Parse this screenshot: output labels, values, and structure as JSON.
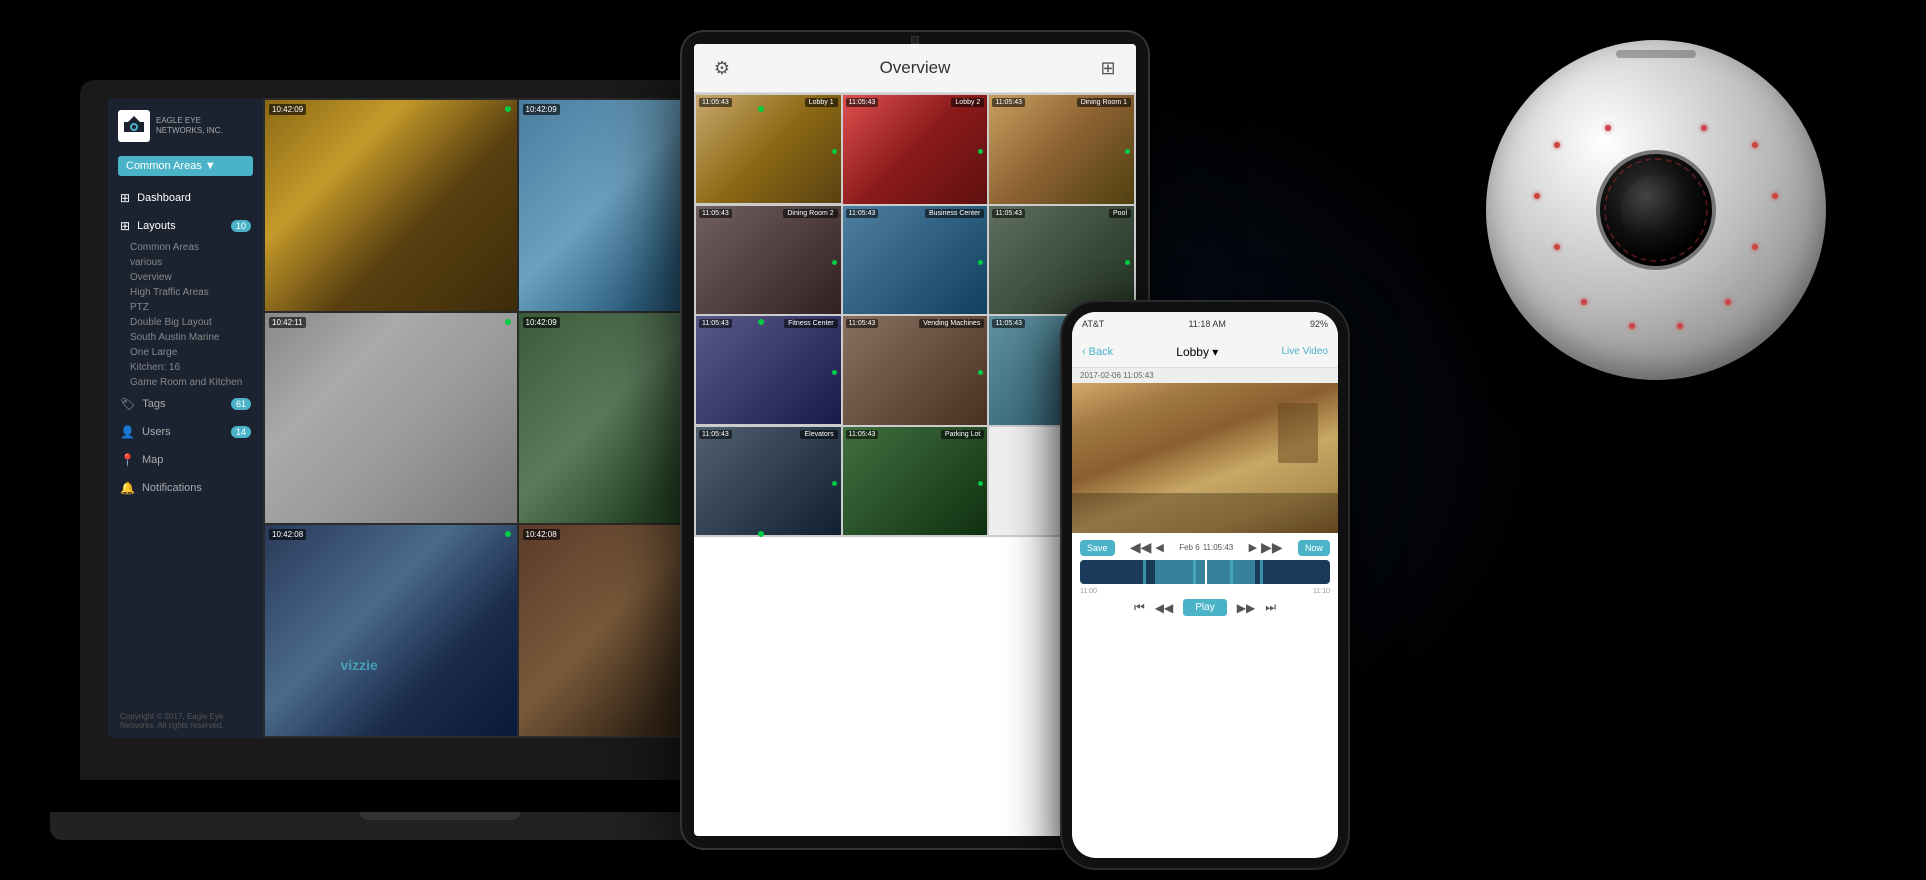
{
  "app": {
    "name": "Eagle Eye Networks",
    "logo_text": "EAGLE EYE\nNETWORKS, INC.",
    "copyright": "Copyright © 2017, Eagle Eye Networks.\nAll rights reserved."
  },
  "laptop": {
    "common_areas_btn": "Common Areas ▼",
    "nav": {
      "dashboard": "Dashboard",
      "layouts": "Layouts",
      "layouts_badge": "10",
      "tags": "Tags",
      "tags_badge": "61",
      "users": "Users",
      "users_badge": "14",
      "map": "Map",
      "notifications": "Notifications"
    },
    "layouts_list": [
      "Common Areas",
      "various",
      "Overview",
      "High Traffic Areas",
      "PTZ",
      "Double Big Layout",
      "South Austin Marine",
      "One Large",
      "Kitchen: 16",
      "Game Room and Kitchen"
    ],
    "cameras": [
      {
        "timestamp": "10:42:09",
        "online": true
      },
      {
        "timestamp": "10:42:09",
        "online": true
      },
      {
        "timestamp": "10:42:11",
        "online": true
      },
      {
        "timestamp": "10:42:09",
        "online": true
      },
      {
        "timestamp": "10:42:08",
        "online": true
      },
      {
        "timestamp": "10:42:08",
        "online": true
      }
    ]
  },
  "tablet": {
    "title": "Overview",
    "cameras": [
      {
        "timestamp": "11:05:43",
        "label": "Lobby 1",
        "online": true
      },
      {
        "timestamp": "11:05:43",
        "label": "Lobby 2",
        "online": true
      },
      {
        "timestamp": "11:05:43",
        "label": "Dining Room 1",
        "online": true
      },
      {
        "timestamp": "11:05:43",
        "label": "Dining Room 2",
        "online": true
      },
      {
        "timestamp": "11:05:43",
        "label": "Business Center",
        "online": true
      },
      {
        "timestamp": "11:05:43",
        "label": "Pool",
        "online": true
      },
      {
        "timestamp": "11:05:43",
        "label": "Fitness Center",
        "online": true
      },
      {
        "timestamp": "11:05:43",
        "label": "Vending Machines",
        "online": true
      },
      {
        "timestamp": "11:05:43",
        "label": "",
        "online": true
      },
      {
        "timestamp": "11:05:43",
        "label": "Elevators",
        "online": true
      },
      {
        "timestamp": "11:05:43",
        "label": "Parking Lot",
        "online": true
      }
    ]
  },
  "phone": {
    "status": {
      "carrier": "AT&T",
      "time": "11:18 AM",
      "battery": "92%"
    },
    "back_label": "Back",
    "lobby_label": "Lobby ▾",
    "live_label": "Live Video",
    "date_label": "2017-02-06 11:05:43",
    "save_btn": "Save",
    "date_nav": "Feb 6",
    "timestamp_nav": "11:05:43",
    "now_btn": "Now",
    "timeline_labels": [
      "11:00",
      "11:10"
    ],
    "play_btn": "Play"
  },
  "dome": {
    "alt": "Dome Security Camera"
  },
  "colors": {
    "accent": "#4ab3c8",
    "sidebar_bg": "#1b2230",
    "online_green": "#00cc44"
  }
}
